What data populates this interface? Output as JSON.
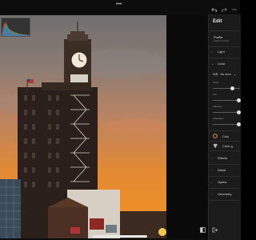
{
  "app": {
    "menu_dots": "•••"
  },
  "panel": {
    "title": "Edit",
    "profile_label": "Profile",
    "profile_value": "Adobe Portrait",
    "sections": {
      "light": "Light",
      "color": "Color",
      "effects": "Effects",
      "detail": "Detail",
      "optics": "Optics",
      "geometry": "Geometry"
    },
    "wb_label": "WB",
    "wb_value": "As shot",
    "temp_label": "Temp",
    "tint_label": "Tint",
    "vibrance_label": "Vibrance",
    "saturation_label": "Saturation",
    "color_mixer_label": "Colo",
    "color_grading_label": "Color g"
  },
  "colors": {
    "sky_top": "#7d7a76",
    "sky_mid": "#c9784a",
    "sky_bottom": "#f08a1c",
    "panel_bg": "#1b1b1b"
  },
  "icons": [
    "undo-icon",
    "redo-icon",
    "more-icon",
    "histogram",
    "compare-icon",
    "exit-icon"
  ]
}
